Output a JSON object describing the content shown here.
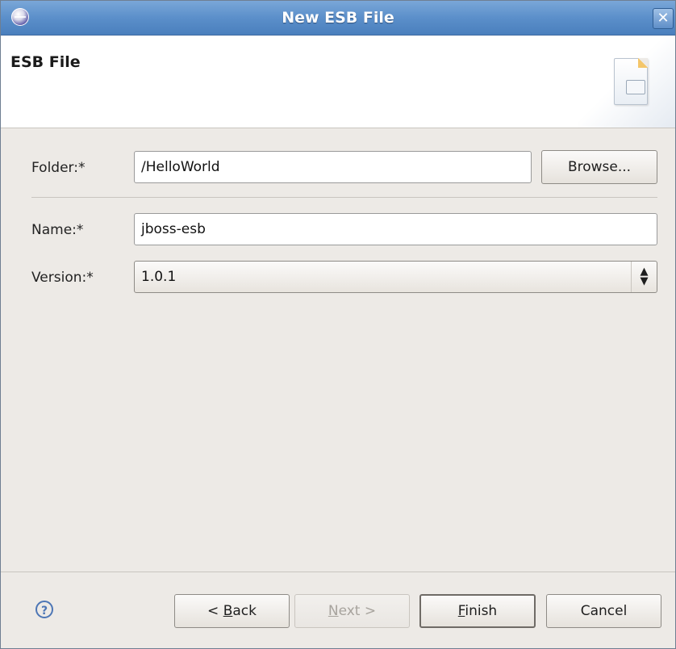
{
  "window": {
    "title": "New ESB File",
    "close_label": "✕"
  },
  "banner": {
    "title": "ESB File",
    "icon": "new-file-wizard-icon"
  },
  "form": {
    "folder": {
      "label": "Folder:*",
      "value": "/HelloWorld",
      "browse_label": "Browse..."
    },
    "name": {
      "label": "Name:*",
      "value": "jboss-esb"
    },
    "version": {
      "label": "Version:*",
      "value": "1.0.1"
    }
  },
  "footer": {
    "help_label": "?",
    "back_prefix": "< ",
    "back_mnemonic": "B",
    "back_rest": "ack",
    "next_mnemonic": "N",
    "next_rest": "ext >",
    "finish_mnemonic": "F",
    "finish_rest": "inish",
    "cancel_label": "Cancel"
  },
  "colors": {
    "title_bar": "#5b8fca",
    "dialog_bg": "#edeae6",
    "banner_bg": "#ffffff"
  }
}
